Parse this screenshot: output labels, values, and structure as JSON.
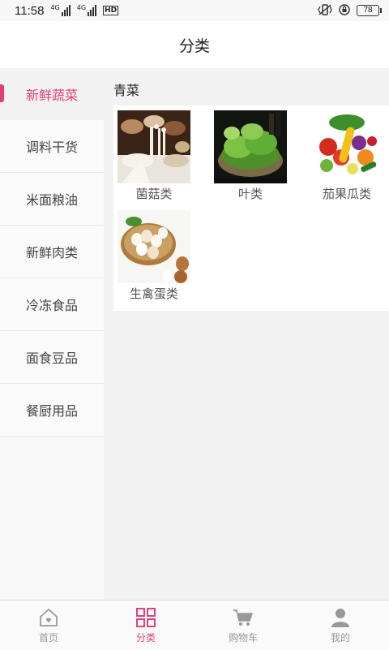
{
  "status_bar": {
    "time": "11:58",
    "net1": "4G",
    "net2": "4G",
    "hd": "HD",
    "battery": "78"
  },
  "header": {
    "title": "分类"
  },
  "sidebar": {
    "items": [
      {
        "label": "新鲜蔬菜",
        "active": true
      },
      {
        "label": "调料干货"
      },
      {
        "label": "米面粮油"
      },
      {
        "label": "新鲜肉类"
      },
      {
        "label": "冷冻食品"
      },
      {
        "label": "面食豆品"
      },
      {
        "label": "餐厨用品"
      }
    ]
  },
  "content": {
    "section_title": "青菜",
    "categories": [
      {
        "label": "菌菇类",
        "icon": "mushroom-image"
      },
      {
        "label": "叶类",
        "icon": "leafy-greens-image"
      },
      {
        "label": "茄果瓜类",
        "icon": "fruit-vegetables-image"
      },
      {
        "label": "生禽蛋类",
        "icon": "eggs-image"
      }
    ]
  },
  "tabbar": {
    "tabs": [
      {
        "label": "首页",
        "icon": "home-icon"
      },
      {
        "label": "分类",
        "icon": "category-grid-icon",
        "active": true
      },
      {
        "label": "购物车",
        "icon": "cart-icon"
      },
      {
        "label": "我的",
        "icon": "user-icon"
      }
    ]
  },
  "colors": {
    "accent": "#e0407a",
    "inactive": "#999999"
  }
}
